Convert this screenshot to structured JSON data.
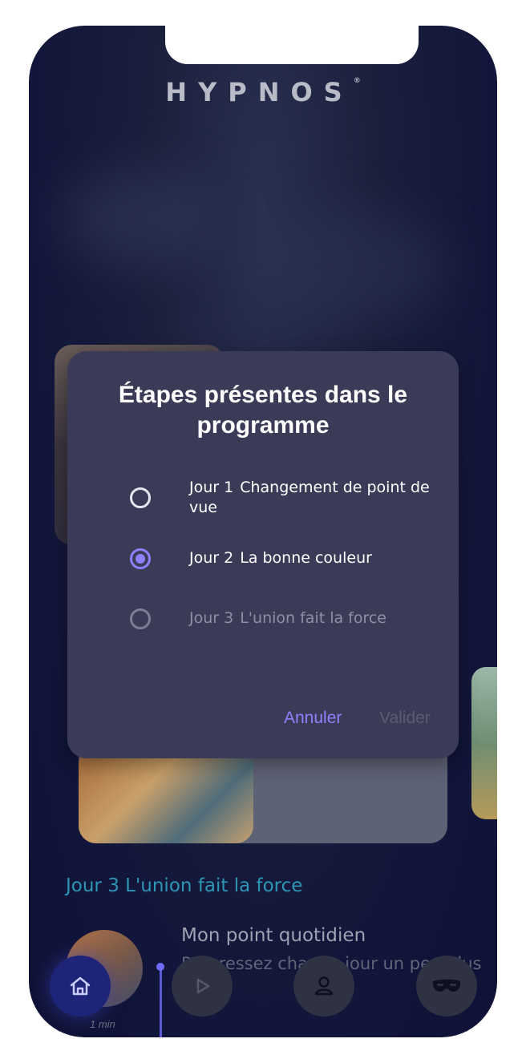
{
  "brand": {
    "logo_text": "HYPNOS",
    "registered": "®"
  },
  "dialog": {
    "title": "Étapes présentes dans le programme",
    "options": [
      {
        "day": "Jour 1",
        "label": "Changement de point de vue",
        "state": "unchecked"
      },
      {
        "day": "Jour 2",
        "label": "La bonne couleur",
        "state": "checked"
      },
      {
        "day": "Jour 3",
        "label": "L'union fait la force",
        "state": "disabled"
      }
    ],
    "cancel_label": "Annuler",
    "validate_label": "Valider"
  },
  "background": {
    "day3_heading": "Jour 3  L'union fait la force",
    "daily_title": "Mon point quotidien",
    "daily_desc": "Progressez chaque jour un peu plus",
    "duration": "1 min"
  },
  "nav": {
    "items": [
      {
        "icon": "home-icon",
        "active": true
      },
      {
        "icon": "play-icon",
        "active": false
      },
      {
        "icon": "profile-icon",
        "active": false
      },
      {
        "icon": "sleep-mask-icon",
        "active": false
      }
    ]
  },
  "colors": {
    "accent": "#8c82ff",
    "dialog_bg": "#3c3b57",
    "day_heading": "#2e95b5",
    "nav_active": "#1e2478"
  }
}
